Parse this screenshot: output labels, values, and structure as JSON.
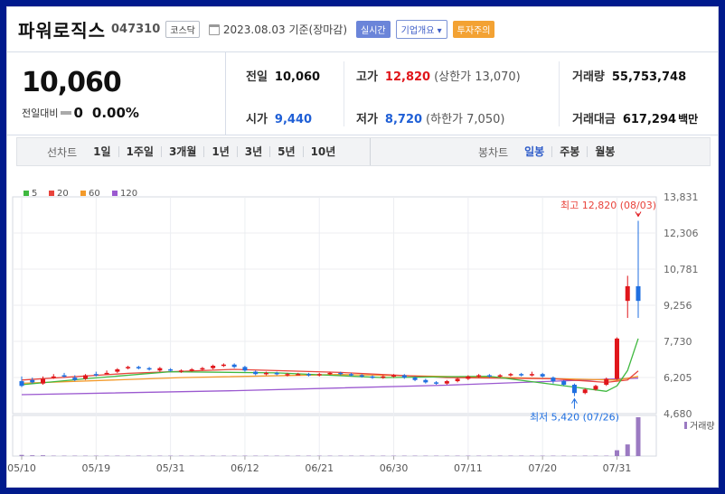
{
  "header": {
    "name": "파워로직스",
    "code": "047310",
    "market": "코스닥",
    "date": "2023.08.03",
    "date_suffix": "기준(장마감)",
    "btn_realtime": "실시간",
    "btn_overview": "기업개요",
    "btn_warning": "투자주의"
  },
  "summary": {
    "price": "10,060",
    "prev_diff_label": "전일대비",
    "prev_diff_value": "0",
    "prev_diff_pct": "0.00%",
    "prev_close_label": "전일",
    "prev_close": "10,060",
    "high_label": "고가",
    "high": "12,820",
    "upper_limit_label": "(상한가",
    "upper_limit": "13,070)",
    "volume_label": "거래량",
    "volume": "55,753,748",
    "open_label": "시가",
    "open": "9,440",
    "low_label": "저가",
    "low": "8,720",
    "lower_limit_label": "(하한가",
    "lower_limit": "7,050)",
    "amount_label": "거래대금",
    "amount": "617,294",
    "amount_unit": "백만"
  },
  "period_bar": {
    "line_label": "선차트",
    "line_periods": [
      "1일",
      "1주일",
      "3개월",
      "1년",
      "3년",
      "5년",
      "10년"
    ],
    "candle_label": "봉차트",
    "candle_periods": [
      "일봉",
      "주봉",
      "월봉"
    ],
    "active": "일봉"
  },
  "colors": {
    "up": "#e0161b",
    "down": "#1f6fe0",
    "ma5": "#3fb83f",
    "ma20": "#e8433b",
    "ma60": "#f39a2a",
    "ma120": "#9b59d0",
    "volume": "#9b7ac2"
  },
  "chart_data": {
    "type": "candlestick",
    "legend": [
      {
        "name": "5",
        "color": "#3fb83f"
      },
      {
        "name": "20",
        "color": "#e8433b"
      },
      {
        "name": "60",
        "color": "#f39a2a"
      },
      {
        "name": "120",
        "color": "#9b59d0"
      }
    ],
    "y_ticks": [
      "13,831",
      "12,306",
      "10,781",
      "9,256",
      "7,730",
      "6,205",
      "4,680"
    ],
    "ylim": [
      4680,
      13831
    ],
    "x_labels": [
      "05/10",
      "05/19",
      "05/31",
      "06/12",
      "06/21",
      "06/30",
      "07/11",
      "07/20",
      "07/31"
    ],
    "x_label_index": [
      0,
      7,
      14,
      21,
      28,
      35,
      42,
      49,
      56
    ],
    "high_annotation": "최고 12,820 (08/03)",
    "low_annotation": "최저 5,420 (07/26)",
    "volume_label": "거래량",
    "candles": [
      [
        6050,
        5850,
        6250,
        5800
      ],
      [
        6100,
        6000,
        6200,
        5950
      ],
      [
        5950,
        6150,
        6250,
        5900
      ],
      [
        6200,
        6250,
        6350,
        6150
      ],
      [
        6300,
        6250,
        6400,
        6200
      ],
      [
        6200,
        6100,
        6300,
        6050
      ],
      [
        6150,
        6300,
        6350,
        6100
      ],
      [
        6350,
        6300,
        6450,
        6250
      ],
      [
        6400,
        6400,
        6500,
        6350
      ],
      [
        6450,
        6550,
        6600,
        6400
      ],
      [
        6600,
        6650,
        6700,
        6550
      ],
      [
        6650,
        6600,
        6700,
        6550
      ],
      [
        6600,
        6550,
        6650,
        6500
      ],
      [
        6500,
        6600,
        6650,
        6450
      ],
      [
        6550,
        6500,
        6600,
        6450
      ],
      [
        6450,
        6500,
        6550,
        6400
      ],
      [
        6500,
        6550,
        6600,
        6450
      ],
      [
        6550,
        6600,
        6650,
        6500
      ],
      [
        6600,
        6700,
        6750,
        6550
      ],
      [
        6700,
        6750,
        6800,
        6650
      ],
      [
        6750,
        6650,
        6800,
        6600
      ],
      [
        6650,
        6500,
        6700,
        6450
      ],
      [
        6450,
        6350,
        6500,
        6300
      ],
      [
        6350,
        6400,
        6450,
        6300
      ],
      [
        6400,
        6350,
        6450,
        6300
      ],
      [
        6300,
        6350,
        6400,
        6250
      ],
      [
        6350,
        6350,
        6400,
        6300
      ],
      [
        6350,
        6300,
        6400,
        6250
      ],
      [
        6300,
        6350,
        6400,
        6250
      ],
      [
        6350,
        6400,
        6450,
        6300
      ],
      [
        6400,
        6350,
        6450,
        6300
      ],
      [
        6350,
        6300,
        6400,
        6250
      ],
      [
        6300,
        6250,
        6350,
        6200
      ],
      [
        6250,
        6200,
        6300,
        6150
      ],
      [
        6200,
        6250,
        6300,
        6150
      ],
      [
        6250,
        6300,
        6350,
        6200
      ],
      [
        6300,
        6200,
        6350,
        6150
      ],
      [
        6200,
        6100,
        6250,
        6050
      ],
      [
        6100,
        6000,
        6150,
        5950
      ],
      [
        6000,
        5950,
        6050,
        5900
      ],
      [
        5950,
        6050,
        6100,
        5900
      ],
      [
        6050,
        6150,
        6200,
        6000
      ],
      [
        6150,
        6250,
        6300,
        6100
      ],
      [
        6250,
        6300,
        6350,
        6200
      ],
      [
        6300,
        6250,
        6350,
        6200
      ],
      [
        6250,
        6300,
        6350,
        6200
      ],
      [
        6300,
        6350,
        6400,
        6250
      ],
      [
        6350,
        6300,
        6400,
        6250
      ],
      [
        6300,
        6350,
        6450,
        6250
      ],
      [
        6350,
        6250,
        6400,
        6200
      ],
      [
        6200,
        6050,
        6250,
        5950
      ],
      [
        6050,
        5900,
        6100,
        5850
      ],
      [
        5900,
        5550,
        5950,
        5420
      ],
      [
        5550,
        5700,
        5750,
        5500
      ],
      [
        5700,
        5850,
        5900,
        5650
      ],
      [
        5900,
        6150,
        6200,
        5850
      ],
      [
        6150,
        7850,
        7900,
        6100
      ],
      [
        9440,
        10060,
        10500,
        8720
      ],
      [
        10060,
        9440,
        12820,
        8720
      ]
    ],
    "ma5": [
      [
        0,
        5900
      ],
      [
        6,
        6150
      ],
      [
        14,
        6450
      ],
      [
        24,
        6400
      ],
      [
        34,
        6200
      ],
      [
        44,
        6260
      ],
      [
        52,
        5800
      ],
      [
        55,
        5620
      ],
      [
        56,
        5850
      ],
      [
        57,
        6500
      ],
      [
        58,
        7850
      ]
    ],
    "ma20": [
      [
        0,
        6100
      ],
      [
        10,
        6380
      ],
      [
        20,
        6550
      ],
      [
        30,
        6420
      ],
      [
        40,
        6200
      ],
      [
        50,
        6150
      ],
      [
        55,
        6000
      ],
      [
        57,
        6100
      ],
      [
        58,
        6480
      ]
    ],
    "ma60": [
      [
        0,
        5960
      ],
      [
        15,
        6200
      ],
      [
        30,
        6330
      ],
      [
        45,
        6210
      ],
      [
        56,
        6100
      ],
      [
        58,
        6250
      ]
    ],
    "ma120": [
      [
        0,
        5480
      ],
      [
        20,
        5650
      ],
      [
        40,
        5880
      ],
      [
        58,
        6180
      ]
    ],
    "volume": [
      3,
      2,
      2,
      1,
      1,
      1,
      1,
      1,
      1,
      1,
      1,
      1,
      1,
      1,
      1,
      1,
      1,
      1,
      1,
      1,
      1,
      1,
      1,
      1,
      1,
      1,
      1,
      1,
      1,
      1,
      1,
      1,
      1,
      1,
      1,
      1,
      1,
      1,
      1,
      1,
      1,
      1,
      1,
      1,
      1,
      1,
      1,
      1,
      1,
      1,
      1,
      1,
      1,
      1,
      1,
      1,
      15,
      30,
      100
    ]
  }
}
